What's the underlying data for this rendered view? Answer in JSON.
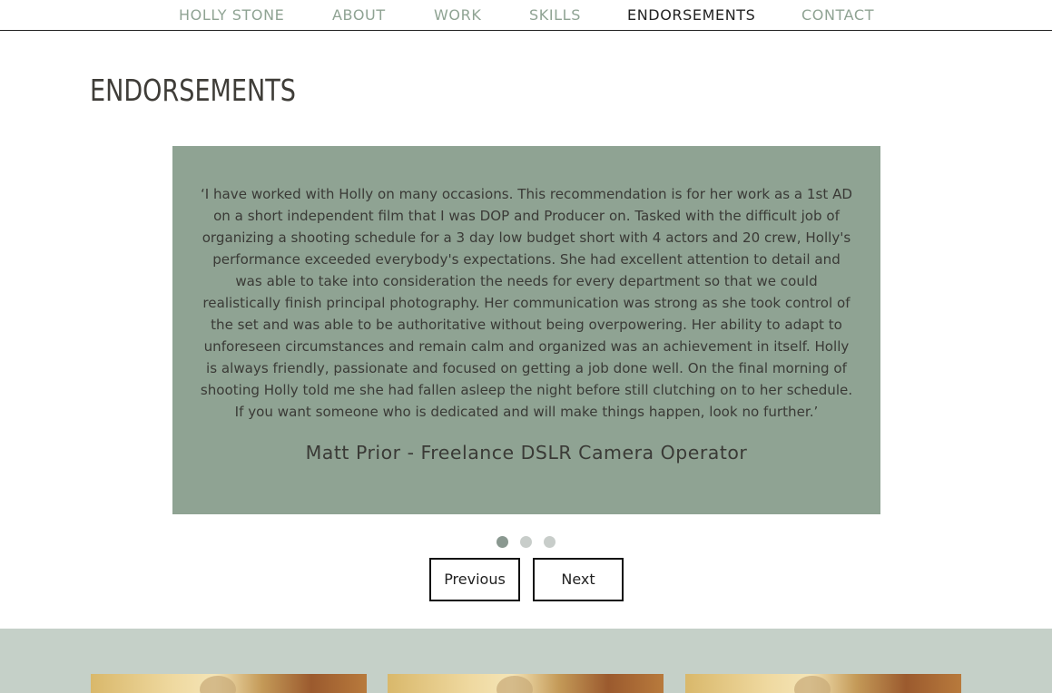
{
  "nav": {
    "items": [
      {
        "label": "HOLLY STONE"
      },
      {
        "label": "ABOUT"
      },
      {
        "label": "WORK"
      },
      {
        "label": "SKILLS"
      },
      {
        "label": "ENDORSEMENTS"
      },
      {
        "label": "CONTACT"
      }
    ],
    "active": "ENDORSEMENTS"
  },
  "section": {
    "title": "ENDORSEMENTS"
  },
  "carousel": {
    "current_slide": 1,
    "slide_count": 3,
    "quote": "‘I have worked with Holly on many occasions. This recommendation is for her work as a 1st AD on a short independent film that I was DOP and Producer on. Tasked with the difficult job of organizing a shooting schedule for a 3 day low budget short with 4 actors and 20 crew, Holly's performance exceeded everybody's expectations. She had excellent attention to detail and was able to take into consideration the needs for every department so that we could realistically finish principal photography. Her communication was strong as she took control of the set and was able to be authoritative without being overpowering. Her ability to adapt to unforeseen circumstances and remain calm and organized was an achievement in itself. Holly is always friendly, passionate and focused on getting a job done well. On the final morning of shooting Holly told me she had fallen asleep the night before still clutching on to her schedule. If you want someone who is dedicated and will make things happen, look no further.’",
    "author": "Matt Prior - Freelance DSLR Camera Operator",
    "prev_label": "Previous",
    "next_label": "Next"
  },
  "colors": {
    "accent": "#8fa393",
    "band": "#c5d0c8",
    "text": "#3a3a36"
  }
}
